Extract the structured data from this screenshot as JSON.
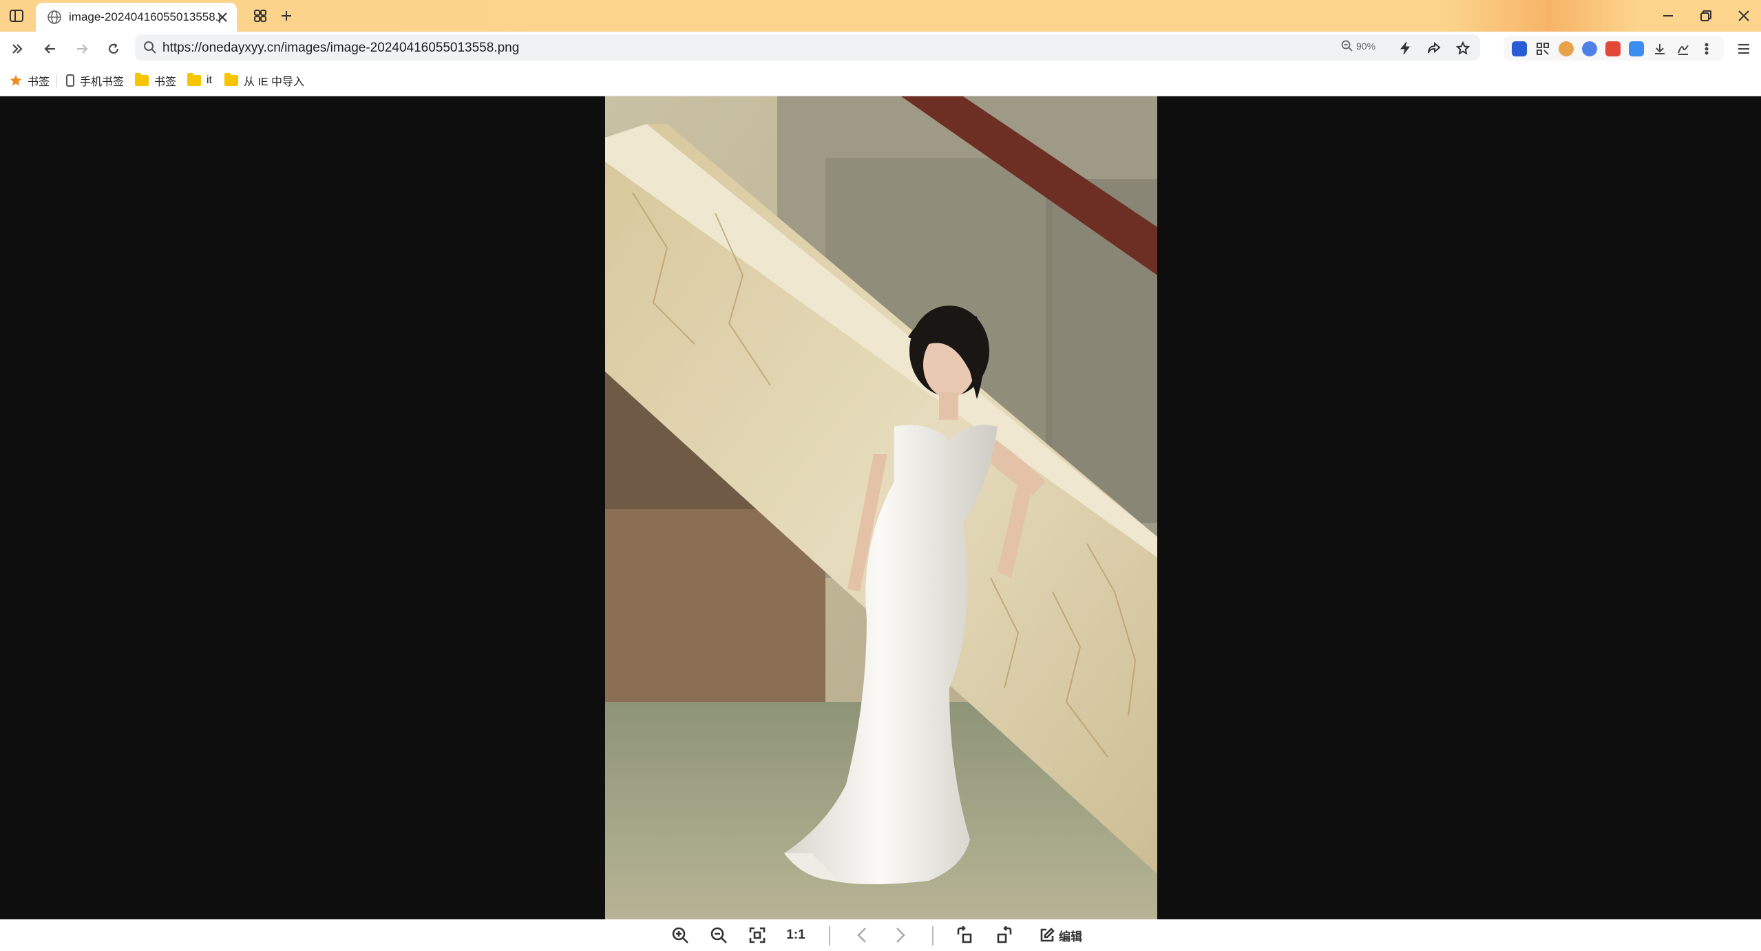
{
  "browser": {
    "tab": {
      "title": "image-20240416055013558.png"
    },
    "address_bar": {
      "url": "https://onedayxyy.cn/images/image-20240416055013558.png",
      "zoom_label": "90%"
    },
    "colors": {
      "tab_strip": "#fcd48c",
      "viewer_background": "#0e0e0e"
    }
  },
  "bookmarks": [
    {
      "label": "书签",
      "icon": "star-icon"
    },
    {
      "label": "手机书签",
      "icon": "phone-icon"
    },
    {
      "label": "书签",
      "icon": "folder-icon"
    },
    {
      "label": "it",
      "icon": "folder-icon"
    },
    {
      "label": "从 IE 中导入",
      "icon": "folder-icon"
    }
  ],
  "viewer_toolbar": {
    "actual_size_label": "1:1",
    "edit_label": "编辑"
  }
}
